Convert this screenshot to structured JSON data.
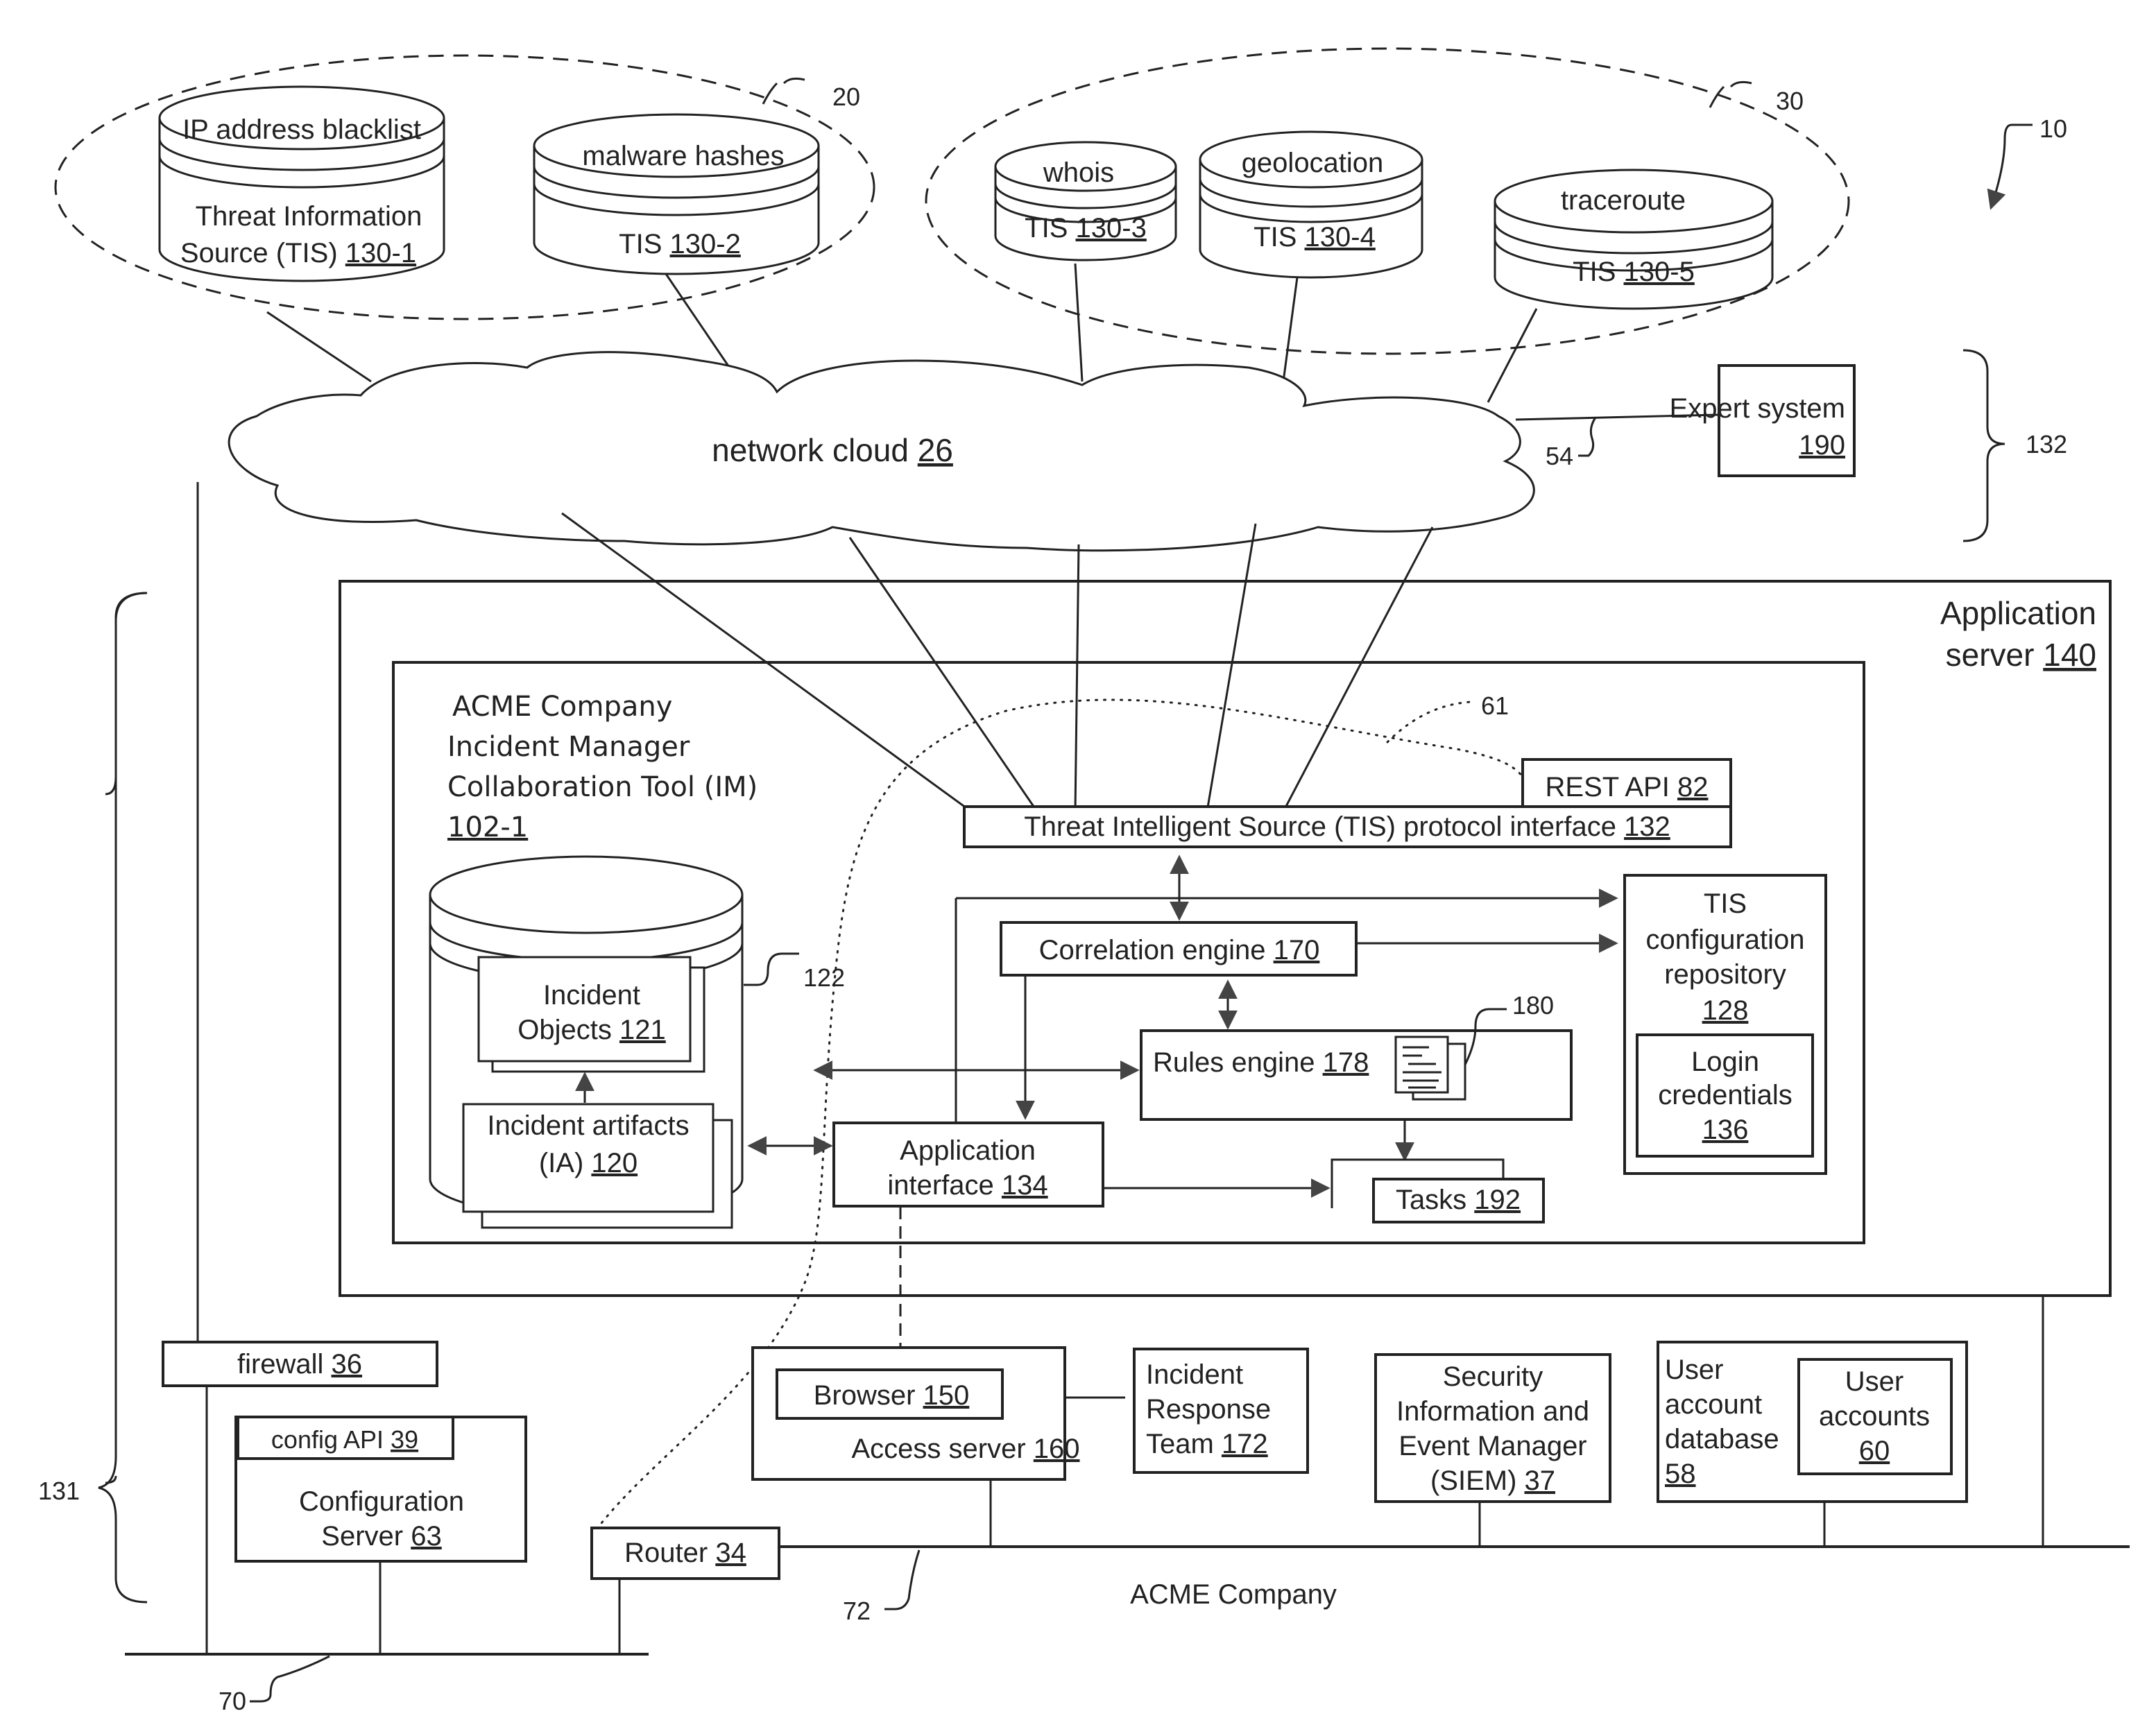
{
  "figure": {
    "ref": "10"
  },
  "groups": {
    "group_20": "20",
    "group_30": "30"
  },
  "tis_sources": [
    {
      "top_label": "IP address blacklist",
      "line1": "Threat Information",
      "line2": "Source (TIS) ",
      "ref": "130-1"
    },
    {
      "top_label": "malware hashes",
      "line1": "",
      "line2": "TIS ",
      "ref": "130-2"
    },
    {
      "top_label": "whois",
      "line1": "",
      "line2": "TIS ",
      "ref": "130-3"
    },
    {
      "top_label": "geolocation",
      "line1": "",
      "line2": "TIS ",
      "ref": "130-4"
    },
    {
      "top_label": "traceroute",
      "line1": "",
      "line2": "TIS ",
      "ref": "130-5"
    }
  ],
  "cloud": {
    "label": "network cloud ",
    "ref": "26"
  },
  "expert_system": {
    "label": "Expert system",
    "ref": "190",
    "link_ref": "54",
    "brace_ref": "132"
  },
  "app_server": {
    "line1": "Application",
    "line2": "server ",
    "ref": "140"
  },
  "incident_manager": {
    "line1": "ACME Company",
    "line2": "Incident Manager",
    "line3": "Collaboration Tool (IM)",
    "ref": "102-1",
    "path_ref": "61"
  },
  "rest_api": {
    "label": "REST API ",
    "ref": "82"
  },
  "tis_protocol_interface": {
    "label": "Threat Intelligent Source (TIS) protocol interface ",
    "ref": "132"
  },
  "database": {
    "ref": "122",
    "incident_objects": {
      "line1": "Incident",
      "line2": "Objects ",
      "ref": "121"
    },
    "incident_artifacts": {
      "line1": "Incident artifacts",
      "line2": "(IA) ",
      "ref": "120"
    }
  },
  "correlation_engine": {
    "label": "Correlation engine ",
    "ref": "170"
  },
  "rules_engine": {
    "label": "Rules engine ",
    "ref": "178",
    "rules_ref": "180"
  },
  "tis_config_repo": {
    "line1": "TIS",
    "line2": "configuration",
    "line3": "repository",
    "ref": "128"
  },
  "login_credentials": {
    "line1": "Login",
    "line2": "credentials",
    "ref": "136"
  },
  "application_interface": {
    "line1": "Application",
    "line2": "interface ",
    "ref": "134"
  },
  "tasks": {
    "label": "Tasks ",
    "ref": "192"
  },
  "firewall": {
    "label": "firewall ",
    "ref": "36"
  },
  "config_api": {
    "label": "config API ",
    "ref": "39"
  },
  "config_server": {
    "line1": "Configuration",
    "line2": "Server ",
    "ref": "63"
  },
  "router": {
    "label": "Router ",
    "ref": "34"
  },
  "browser": {
    "label": "Browser ",
    "ref": "150"
  },
  "access_server": {
    "label": "Access server ",
    "ref": "160"
  },
  "incident_response_team": {
    "line1": "Incident",
    "line2": "Response",
    "line3": "Team ",
    "ref": "172"
  },
  "siem": {
    "line1": "Security",
    "line2": "Information and",
    "line3": "Event Manager",
    "line4": "(SIEM) ",
    "ref": "37"
  },
  "user_account_db": {
    "line1": "User",
    "line2": "account",
    "line3": "database",
    "ref": "58"
  },
  "user_accounts": {
    "line1": "User",
    "line2": "accounts",
    "ref": "60"
  },
  "networks": {
    "company_label": "ACME Company",
    "network_70": "70",
    "network_72": "72",
    "brace_131": "131"
  }
}
